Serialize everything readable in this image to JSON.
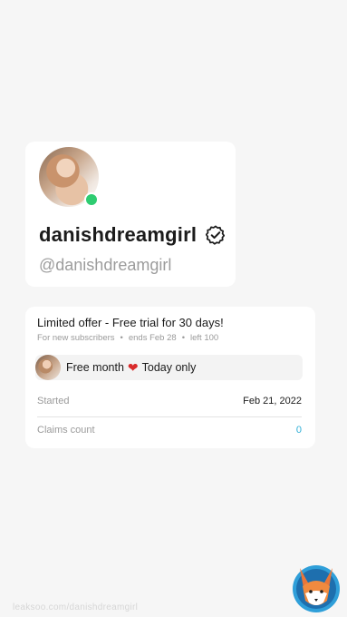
{
  "profile": {
    "display_name": "danishdreamgirl",
    "username": "@danishdreamgirl",
    "verified": true,
    "online": true
  },
  "offer": {
    "title": "Limited offer - Free trial for 30 days!",
    "meta": {
      "audience": "For new subscribers",
      "ends": "ends Feb 28",
      "left": "left 100"
    },
    "promo": {
      "text_before": "Free month",
      "text_after": "Today only"
    },
    "started_label": "Started",
    "started_value": "Feb 21, 2022",
    "claims_label": "Claims count",
    "claims_value": "0"
  },
  "watermark": {
    "text": "leaksoo.com/danishdreamgirl"
  },
  "colors": {
    "background": "#f6f6f6",
    "online": "#2ecc71",
    "link": "#2eaed6",
    "heart": "#d92b2b"
  },
  "icons": {
    "verified": "verified-badge-icon",
    "heart": "heart-icon",
    "watermark_logo": "fox-logo"
  }
}
